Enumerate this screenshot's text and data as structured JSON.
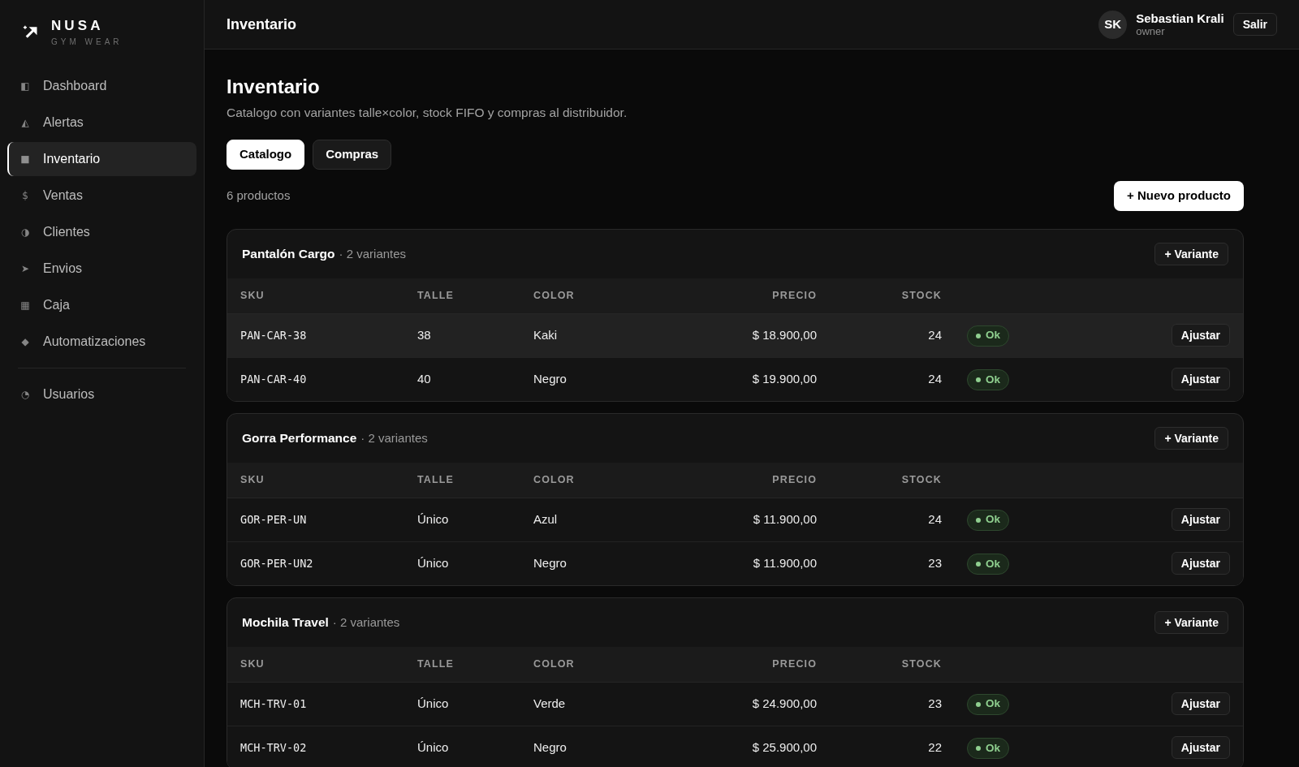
{
  "sidebar": {
    "brand": {
      "name": "NUSA",
      "tagline": "GYM WEAR"
    },
    "items": [
      {
        "icon": "◧",
        "label": "Dashboard",
        "selected": false
      },
      {
        "icon": "◭",
        "label": "Alertas",
        "selected": false
      },
      {
        "icon": "■",
        "label": "Inventario",
        "selected": true
      },
      {
        "icon": "$",
        "label": "Ventas",
        "selected": false
      },
      {
        "icon": "◑",
        "label": "Clientes",
        "selected": false
      },
      {
        "icon": "➤",
        "label": "Envios",
        "selected": false
      },
      {
        "icon": "▦",
        "label": "Caja",
        "selected": false
      },
      {
        "icon": "◆",
        "label": "Automatizaciones",
        "selected": false
      }
    ],
    "footer_items": [
      {
        "icon": "◔",
        "label": "Usuarios",
        "selected": false
      }
    ]
  },
  "topbar": {
    "title": "Inventario",
    "user": {
      "initials": "SK",
      "name": "Sebastian Krali",
      "role": "owner"
    },
    "logout": "Salir"
  },
  "page": {
    "title": "Inventario",
    "subtitle": "Catalogo con variantes talle×color, stock FIFO y compras al distribuidor.",
    "tabs": [
      {
        "label": "Catalogo",
        "selected": true
      },
      {
        "label": "Compras",
        "selected": false
      }
    ],
    "count": "6 productos",
    "new_button": "+ Nuevo producto"
  },
  "products": [
    {
      "name": "Pantalón Cargo",
      "variants": "· 2 variantes",
      "add_button": "+ Variante",
      "columns": [
        "SKU",
        "TALLE",
        "COLOR",
        "PRECIO",
        "STOCK"
      ],
      "rows": [
        {
          "sku": "PAN-CAR-38",
          "talle": "38",
          "color_label": "Kaki",
          "precio": "$ 18.900,00",
          "stock": "24",
          "status": "Ok",
          "alert": false,
          "action": "Ajustar",
          "hovered": true
        },
        {
          "sku": "PAN-CAR-40",
          "talle": "40",
          "color_label": "Negro",
          "precio": "$ 19.900,00",
          "stock": "24",
          "status": "Ok",
          "alert": false,
          "action": "Ajustar",
          "hovered": false
        }
      ]
    },
    {
      "name": "Gorra Performance",
      "variants": "· 2 variantes",
      "add_button": "+ Variante",
      "columns": [
        "SKU",
        "TALLE",
        "COLOR",
        "PRECIO",
        "STOCK"
      ],
      "rows": [
        {
          "sku": "GOR-PER-UN",
          "talle": "Único",
          "color_label": "Azul",
          "precio": "$ 11.900,00",
          "stock": "24",
          "status": "Ok",
          "alert": false,
          "action": "Ajustar",
          "hovered": false
        },
        {
          "sku": "GOR-PER-UN2",
          "talle": "Único",
          "color_label": "Negro",
          "precio": "$ 11.900,00",
          "stock": "23",
          "status": "Ok",
          "alert": false,
          "action": "Ajustar",
          "hovered": false
        }
      ]
    },
    {
      "name": "Mochila Travel",
      "variants": "· 2 variantes",
      "add_button": "+ Variante",
      "columns": [
        "SKU",
        "TALLE",
        "COLOR",
        "PRECIO",
        "STOCK"
      ],
      "rows": [
        {
          "sku": "MCH-TRV-01",
          "talle": "Único",
          "color_label": "Verde",
          "precio": "$ 24.900,00",
          "stock": "23",
          "status": "Ok",
          "alert": false,
          "action": "Ajustar",
          "hovered": false
        },
        {
          "sku": "MCH-TRV-02",
          "talle": "Único",
          "color_label": "Negro",
          "precio": "$ 25.900,00",
          "stock": "22",
          "status": "Ok",
          "alert": false,
          "action": "Ajustar",
          "hovered": false
        }
      ]
    }
  ]
}
